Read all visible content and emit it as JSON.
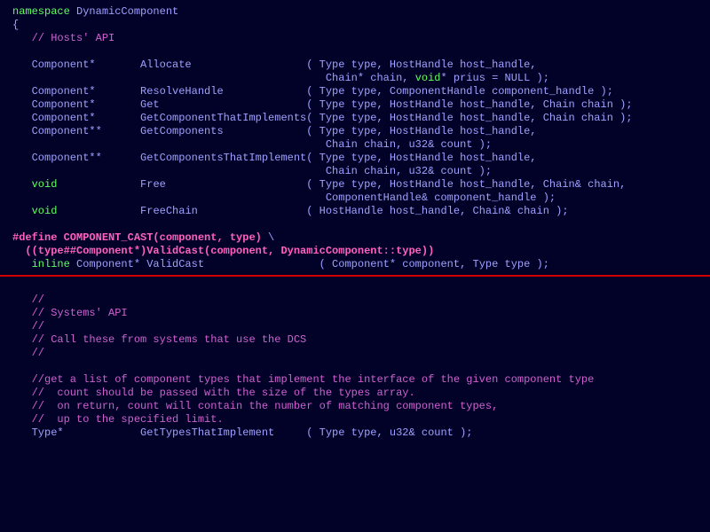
{
  "line01_kw": "namespace",
  "line01_id": " DynamicComponent",
  "line02": "{",
  "line03_cm": "   // Hosts' API",
  "blank": "",
  "line05a": "   Component*       Allocate                  ( Type type, HostHandle host_handle,",
  "line06a": "                                                 Chain* chain, ",
  "line06kw": "void",
  "line06b": "* prius = NULL );",
  "line07": "   Component*       ResolveHandle             ( Type type, ComponentHandle component_handle );",
  "line08": "   Component*       Get                       ( Type type, HostHandle host_handle, Chain chain );",
  "line09": "   Component*       GetComponentThatImplements( Type type, HostHandle host_handle, Chain chain );",
  "line10": "   Component**      GetComponents             ( Type type, HostHandle host_handle,",
  "line11": "                                                 Chain chain, u32& count );",
  "line12": "   Component**      GetComponentsThatImplement( Type type, HostHandle host_handle,",
  "line13": "                                                 Chain chain, u32& count );",
  "line14kw": "   void",
  "line14b": "             Free                      ( Type type, HostHandle host_handle, Chain& chain,",
  "line15": "                                                 ComponentHandle& component_handle );",
  "line16kw": "   void",
  "line16b": "             FreeChain                 ( HostHandle host_handle, Chain& chain );",
  "line18pp": "#define COMPONENT_CAST(component, type) ",
  "line18bk": "\\",
  "line19pp": "  ((type##Component*)ValidCast(component, DynamicComponent::type))",
  "line20kw": "   inline",
  "line20b": " Component* ValidCast                  ( Component* component, Type type );",
  "cmA": "   //",
  "cmB": "   // Systems' API",
  "cmC": "   //",
  "cmD": "   // Call these from systems that use the DCS",
  "cmE": "   //",
  "cmF": "   //get a list of component types that implement the interface of the given component type",
  "cmG": "   //  count should be passed with the size of the types array.",
  "cmH": "   //  on return, count will contain the number of matching component types,",
  "cmI": "   //  up to the specified limit.",
  "lineTI": "   Type*            GetTypesThatImplement     ( Type type, u32& count );"
}
